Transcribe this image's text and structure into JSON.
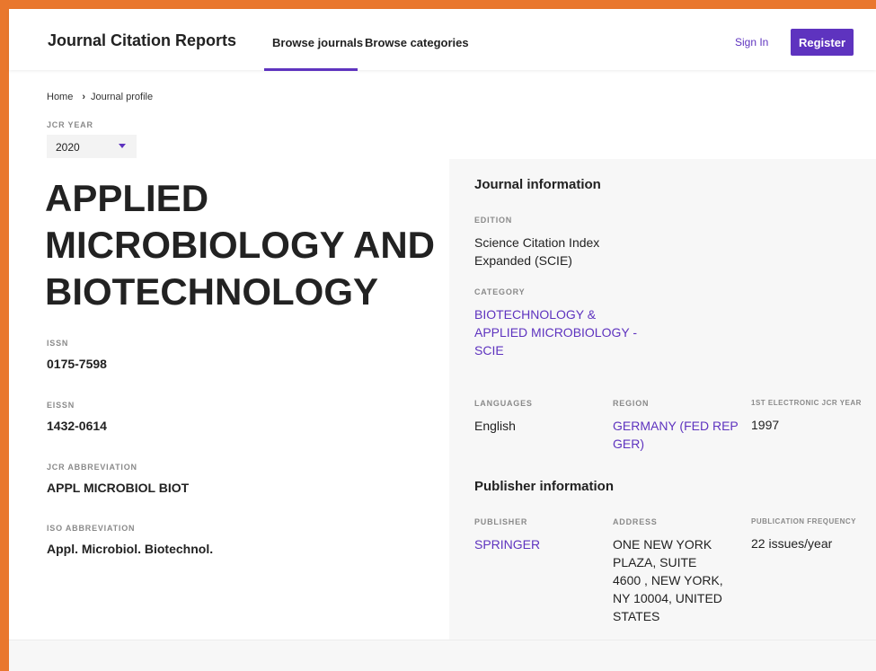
{
  "nav": {
    "brand": "Journal Citation Reports",
    "links": [
      "Browse journals",
      "Browse categories"
    ],
    "sign_in": "Sign In",
    "register": "Register"
  },
  "breadcrumb": {
    "home": "Home",
    "current": "Journal profile"
  },
  "jcr_year": {
    "label": "JCR YEAR",
    "value": "2020"
  },
  "journal": {
    "title_lines": [
      "APPLIED",
      "MICROBIOLOGY AND",
      "BIOTECHNOLOGY"
    ],
    "issn_label": "ISSN",
    "issn": "0175-7598",
    "eissn_label": "EISSN",
    "eissn": "1432-0614",
    "jcr_abbrev_label": "JCR ABBREVIATION",
    "jcr_abbrev": "APPL MICROBIOL BIOT",
    "iso_abbrev_label": "ISO ABBREVIATION",
    "iso_abbrev": "Appl. Microbiol. Biotechnol."
  },
  "journal_info": {
    "heading": "Journal information",
    "edition_label": "EDITION",
    "edition_lines": [
      "Science Citation Index",
      "Expanded (SCIE)"
    ],
    "category_label": "CATEGORY",
    "category_lines": [
      "BIOTECHNOLOGY &",
      "APPLIED MICROBIOLOGY -",
      "SCIE"
    ],
    "languages_label": "LANGUAGES",
    "languages": "English",
    "region_label": "REGION",
    "region_lines": [
      "GERMANY (FED REP",
      "GER)"
    ],
    "first_year_label": "1ST ELECTRONIC JCR YEAR",
    "first_year": "1997"
  },
  "publisher_info": {
    "heading": "Publisher information",
    "publisher_label": "PUBLISHER",
    "publisher": "SPRINGER",
    "address_label": "ADDRESS",
    "address_lines": [
      "ONE NEW YORK",
      "PLAZA, SUITE",
      "4600 , NEW YORK,",
      "NY 10004, UNITED",
      "STATES"
    ],
    "frequency_label": "PUBLICATION FREQUENCY",
    "frequency": "22 issues/year"
  },
  "colors": {
    "accent": "#5e33bf",
    "frame": "#e9772d",
    "panel": "#f7f7f7"
  }
}
